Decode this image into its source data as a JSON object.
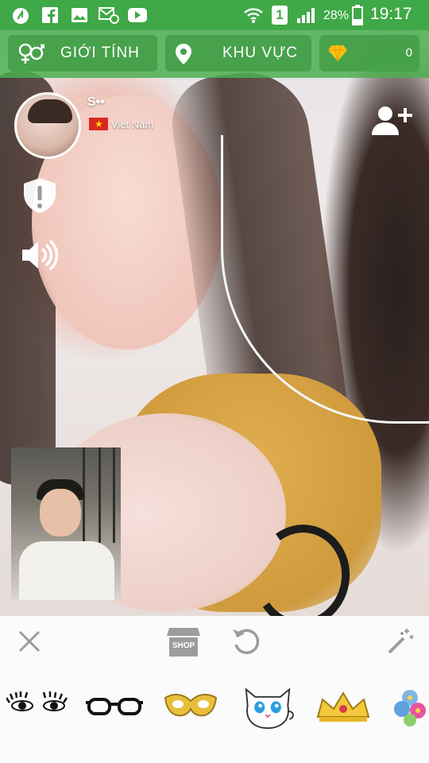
{
  "status_bar": {
    "battery": "28%",
    "time": "19:17",
    "sim": "1",
    "left_icons": [
      "app-icon",
      "facebook-icon",
      "gallery-icon",
      "message-icon",
      "youtube-icon"
    ],
    "right_icons": [
      "wifi-icon",
      "sim-icon",
      "signal-icon",
      "battery-icon"
    ]
  },
  "top_bar": {
    "gender_label": "GIỚI TÍNH",
    "region_label": "KHU VỰC",
    "diamond_count": "0"
  },
  "partner": {
    "name": "S••",
    "country": "Viet Nam"
  },
  "bottom_panel": {
    "shop_label": "SHOP",
    "stickers": [
      "eyelashes-sticker",
      "glasses-sticker",
      "mask-sticker",
      "cat-sticker",
      "crown-sticker",
      "flower-sticker"
    ]
  },
  "colors": {
    "status_bar": "#3fa847",
    "top_bar": "#4caf50",
    "diamond": "#ffc20e",
    "bottom_icons": "#9c9c9c"
  }
}
